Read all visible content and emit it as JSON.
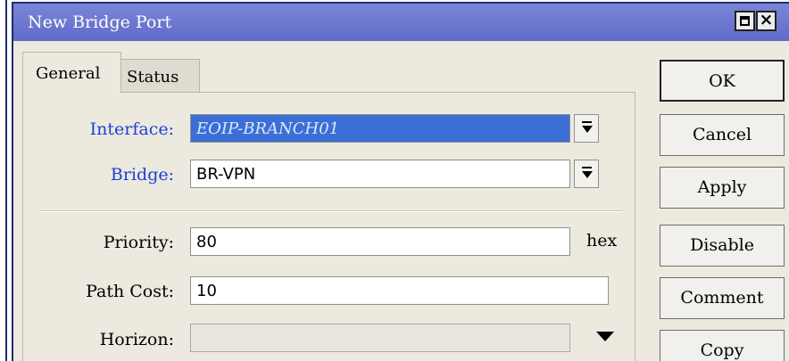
{
  "window": {
    "title": "New Bridge Port"
  },
  "tabs": [
    {
      "label": "General",
      "active": true
    },
    {
      "label": "Status",
      "active": false
    }
  ],
  "form": {
    "interface": {
      "label": "Interface:",
      "value": "EOIP-BRANCH01"
    },
    "bridge": {
      "label": "Bridge:",
      "value": "BR-VPN"
    },
    "priority": {
      "label": "Priority:",
      "value": "80",
      "unit": "hex"
    },
    "path_cost": {
      "label": "Path Cost:",
      "value": "10"
    },
    "horizon": {
      "label": "Horizon:",
      "value": ""
    }
  },
  "buttons": {
    "ok": "OK",
    "cancel": "Cancel",
    "apply": "Apply",
    "disable": "Disable",
    "comment": "Comment",
    "copy": "Copy"
  },
  "icons": {
    "maximize": "maximize-icon",
    "close": "close-icon",
    "dropdown": "dropdown-arrow-icon"
  },
  "colors": {
    "titlebar": "#6f7bd0",
    "label_accent": "#1f3fd6",
    "selection": "#3b6fd6",
    "window_bg": "#ece9df"
  }
}
